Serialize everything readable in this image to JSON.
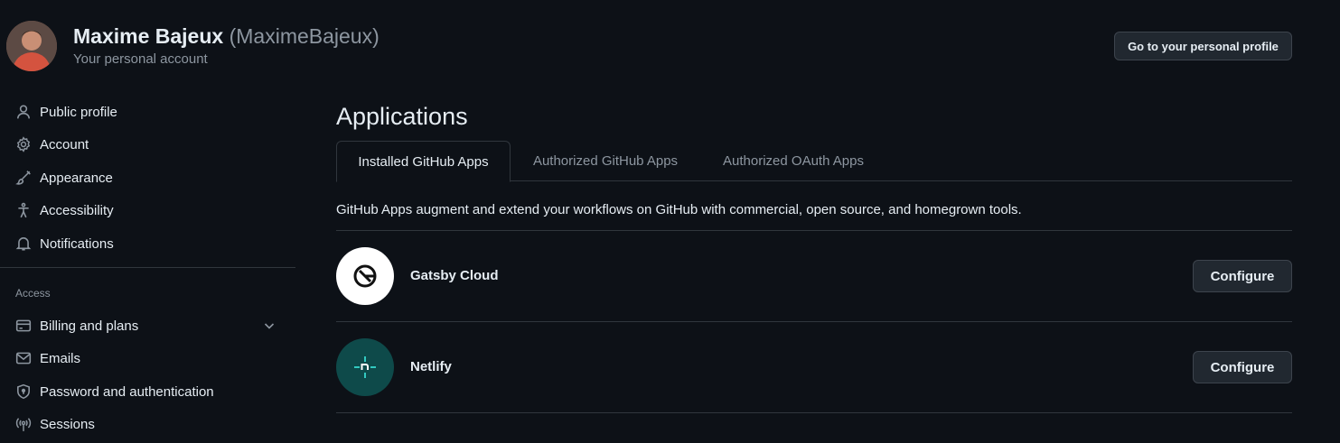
{
  "header": {
    "name": "Maxime Bajeux",
    "login": "(MaximeBajeux)",
    "subtitle": "Your personal account",
    "profile_button": "Go to your personal profile"
  },
  "sidebar": {
    "items": [
      {
        "label": "Public profile",
        "icon": "person-icon"
      },
      {
        "label": "Account",
        "icon": "gear-icon"
      },
      {
        "label": "Appearance",
        "icon": "paintbrush-icon"
      },
      {
        "label": "Accessibility",
        "icon": "accessibility-icon"
      },
      {
        "label": "Notifications",
        "icon": "bell-icon"
      }
    ],
    "access_heading": "Access",
    "access_items": [
      {
        "label": "Billing and plans",
        "icon": "credit-card-icon"
      },
      {
        "label": "Emails",
        "icon": "mail-icon"
      },
      {
        "label": "Password and authentication",
        "icon": "shield-lock-icon"
      },
      {
        "label": "Sessions",
        "icon": "broadcast-icon"
      }
    ]
  },
  "main": {
    "title": "Applications",
    "tabs": [
      {
        "label": "Installed GitHub Apps",
        "active": true
      },
      {
        "label": "Authorized GitHub Apps",
        "active": false
      },
      {
        "label": "Authorized OAuth Apps",
        "active": false
      }
    ],
    "description": "GitHub Apps augment and extend your workflows on GitHub with commercial, open source, and homegrown tools.",
    "apps": [
      {
        "name": "Gatsby Cloud",
        "button": "Configure",
        "logo": "gatsby-logo-icon",
        "logo_bg": "#ffffff"
      },
      {
        "name": "Netlify",
        "button": "Configure",
        "logo": "netlify-logo-icon",
        "logo_bg": "#0e4a4a"
      }
    ]
  },
  "colors": {
    "background": "#0d1117",
    "border": "#30363d",
    "text": "#e6edf3",
    "muted": "#8d96a0",
    "button_bg": "#212830"
  }
}
